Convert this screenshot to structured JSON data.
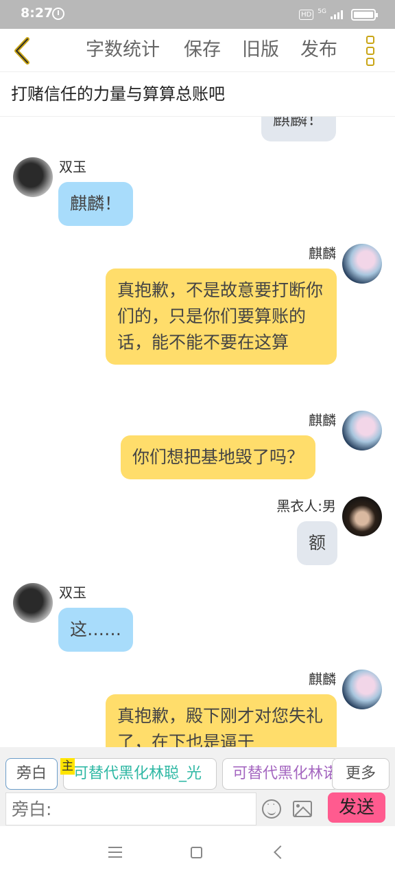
{
  "status_bar": {
    "time": "8:27",
    "hd": "HD",
    "network": "5G"
  },
  "toolbar": {
    "word_count": "字数统计",
    "save": "保存",
    "old_version": "旧版",
    "publish": "发布"
  },
  "document": {
    "title": "打赌信任的力量与算算总账吧"
  },
  "messages": [
    {
      "name": "",
      "text": "麒麟！"
    },
    {
      "name": "双玉",
      "text": "麒麟！"
    },
    {
      "name": "麒麟",
      "text": "真抱歉，不是故意要打断你们的，只是你们要算账的话，能不能不要在这算"
    },
    {
      "name": "麒麟",
      "text": "你们想把基地毁了吗？"
    },
    {
      "name": "黑衣人:男",
      "text": "额"
    },
    {
      "name": "双玉",
      "text": "这……"
    },
    {
      "name": "麒麟",
      "text": "真抱歉，殿下刚才对您失礼了，在下也是逼于"
    }
  ],
  "input_panel": {
    "narrator_chip": "旁白",
    "main_badge": "主",
    "character_chip_1": "可替代黑化林聪_光",
    "character_chip_2": "可替代黑化林诺",
    "more_chip": "更多",
    "input_placeholder": "旁白:",
    "send": "发送"
  },
  "colors": {
    "accent_yellow": "#ffdd6b",
    "bubble_blue": "#a8dcfb",
    "bubble_gray": "#e2e7ee",
    "send_pink": "#ff5b8f",
    "icon_gold": "#c9a516"
  }
}
